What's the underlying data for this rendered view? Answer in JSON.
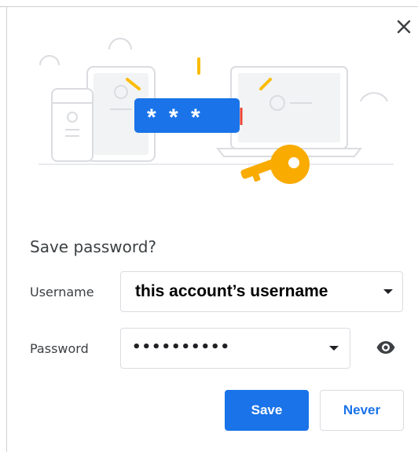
{
  "dialog": {
    "title": "Save password?",
    "close_icon": "close-icon",
    "illustration": {
      "mask_text": "* * *",
      "colors": {
        "accent": "#1a73e8",
        "key": "#f9ab00",
        "sparkle": "#fbbc04",
        "cursor": "#ea4335",
        "outline": "#dadce0"
      }
    }
  },
  "fields": {
    "username": {
      "label": "Username",
      "value": "this account’s username"
    },
    "password": {
      "label": "Password",
      "value": "••••••••••",
      "reveal_icon": "eye-icon"
    }
  },
  "actions": {
    "save_label": "Save",
    "never_label": "Never"
  },
  "colors": {
    "primary": "#1a73e8",
    "text": "#3c4043",
    "border": "#dadce0"
  }
}
